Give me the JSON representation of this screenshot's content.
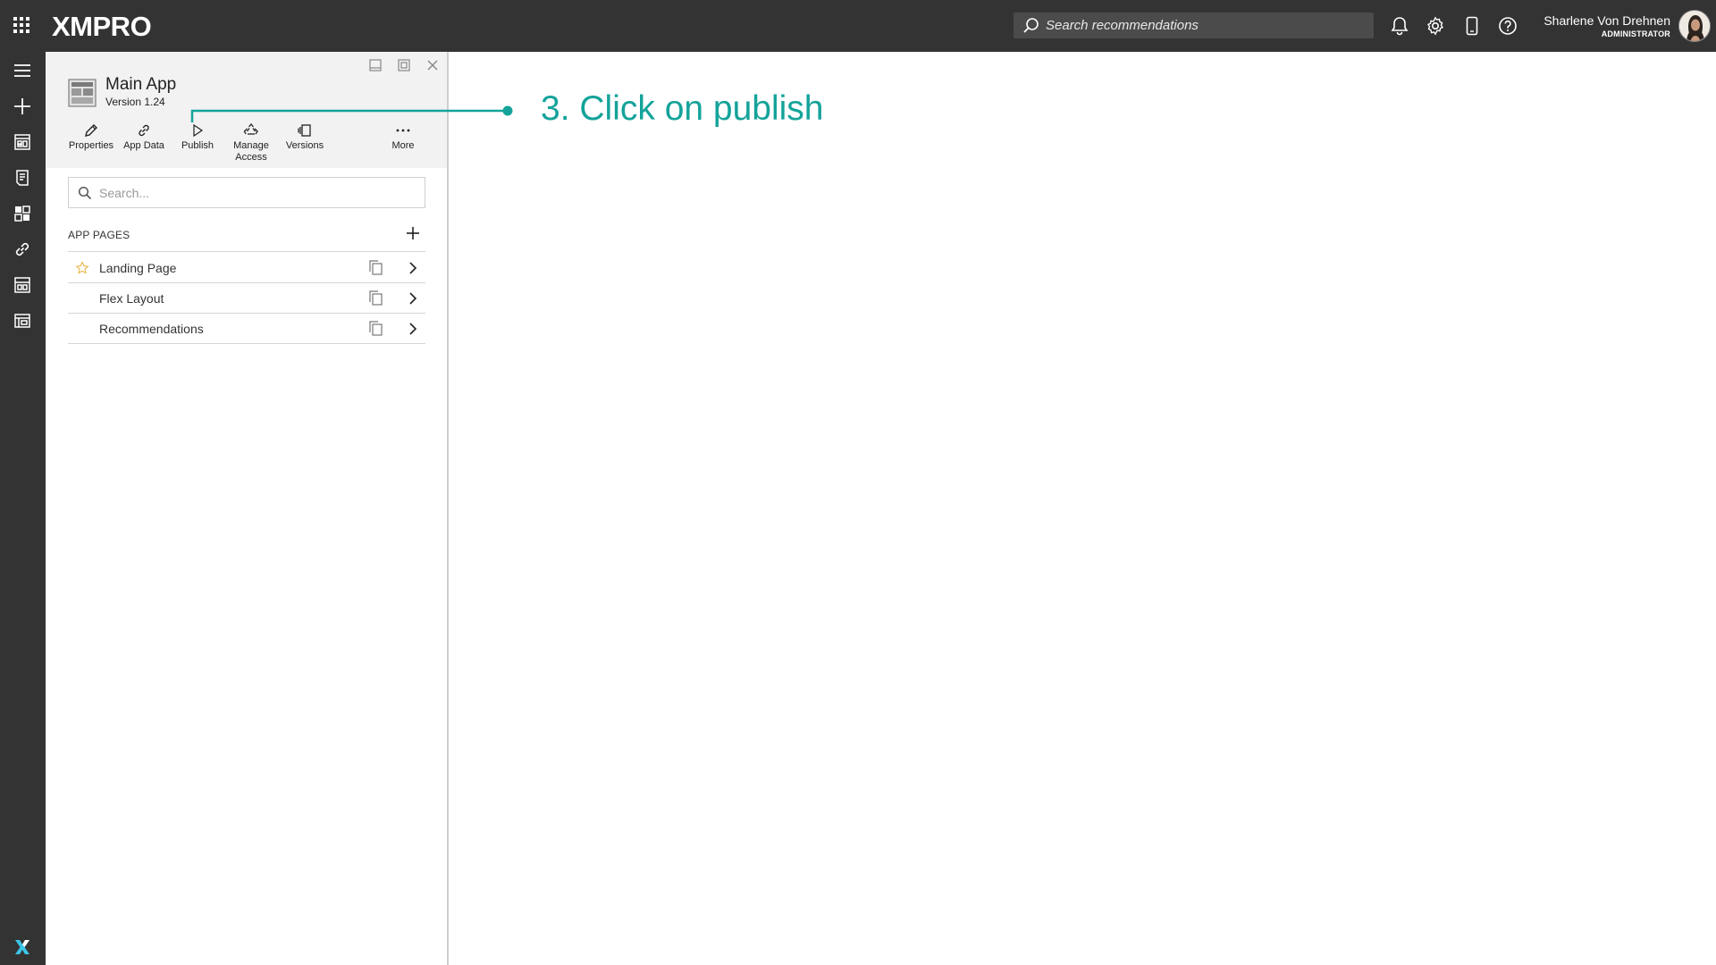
{
  "topbar": {
    "logo": "XMPRO",
    "search_placeholder": "Search recommendations",
    "user_name": "Sharlene Von Drehnen",
    "user_role": "ADMINISTRATOR",
    "icons": [
      "apps-grid-icon",
      "bell-icon",
      "gear-icon",
      "mobile-icon",
      "help-icon"
    ]
  },
  "rail": {
    "items": [
      "menu-icon",
      "add-icon",
      "dashboard-icon",
      "recommendations-icon",
      "apps-icon",
      "link-icon",
      "data-stream-icon",
      "app-designer-icon"
    ]
  },
  "panel": {
    "app_title": "Main App",
    "app_version": "Version 1.24",
    "toolbar": {
      "properties": "Properties",
      "app_data": "App Data",
      "publish": "Publish",
      "manage_access_1": "Manage",
      "manage_access_2": "Access",
      "versions": "Versions",
      "more": "More"
    },
    "search_placeholder": "Search...",
    "section_title": "APP PAGES",
    "pages": [
      {
        "name": "Landing Page",
        "landing": true
      },
      {
        "name": "Flex Layout",
        "landing": false
      },
      {
        "name": "Recommendations",
        "landing": false
      }
    ]
  },
  "annotation": {
    "text": "3. Click on publish",
    "color": "#14a39a"
  }
}
